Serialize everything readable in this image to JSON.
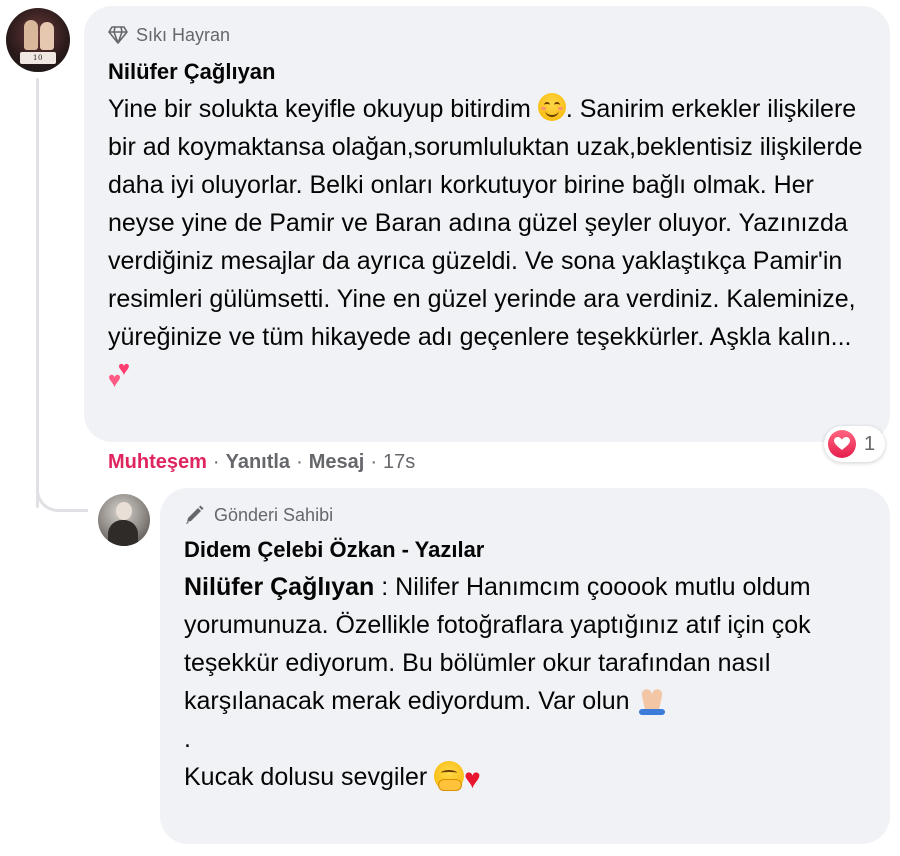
{
  "comment": {
    "badge": "Sıkı Hayran",
    "badge_icon": "diamond-icon",
    "author": "Nilüfer Çağlıyan",
    "avatar_caption": "10 KASIM",
    "text_part1": "Yine bir solukta keyifle okuyup bitirdim ",
    "text_part2": ". Sanirim erkekler ilişkilere bir ad koymaktansa olağan,sorumluluktan uzak,beklentisiz ilişkilerde daha iyi oluyorlar. Belki onları korkutuyor birine bağlı olmak. Her neyse yine de Pamir ve Baran adına güzel şeyler oluyor. Yazınızda verdiğiniz mesajlar da ayrıca güzeldi. Ve sona yaklaştıkça Pamir'in resimleri gülümsetti. Yine en güzel yerinde ara verdiniz. Kaleminize, yüreğinize ve tüm hikayede adı geçenlere teşekkürler. Aşkla kalın...",
    "reaction_count": "1",
    "reaction_color": "#e0245e",
    "actions": {
      "reaction": "Muhteşem",
      "reply": "Yanıtla",
      "message": "Mesaj",
      "separator": "·",
      "time": "17s"
    }
  },
  "reply": {
    "badge": "Gönderi Sahibi",
    "badge_icon": "pen-icon",
    "author": "Didem Çelebi Özkan - Yazılar",
    "mention": "Nilüfer Çağlıyan",
    "line1_rest": " : Nilifer Hanımcım çooook mutlu oldum yorumunuza. Özellikle fotoğraflara yaptığınız atıf için çok teşekkür ediyorum. Bu bölümler okur tarafından nasıl karşılanacak merak ediyordum. Var olun ",
    "dot_line": ".",
    "closing": "Kucak dolusu sevgiler "
  }
}
